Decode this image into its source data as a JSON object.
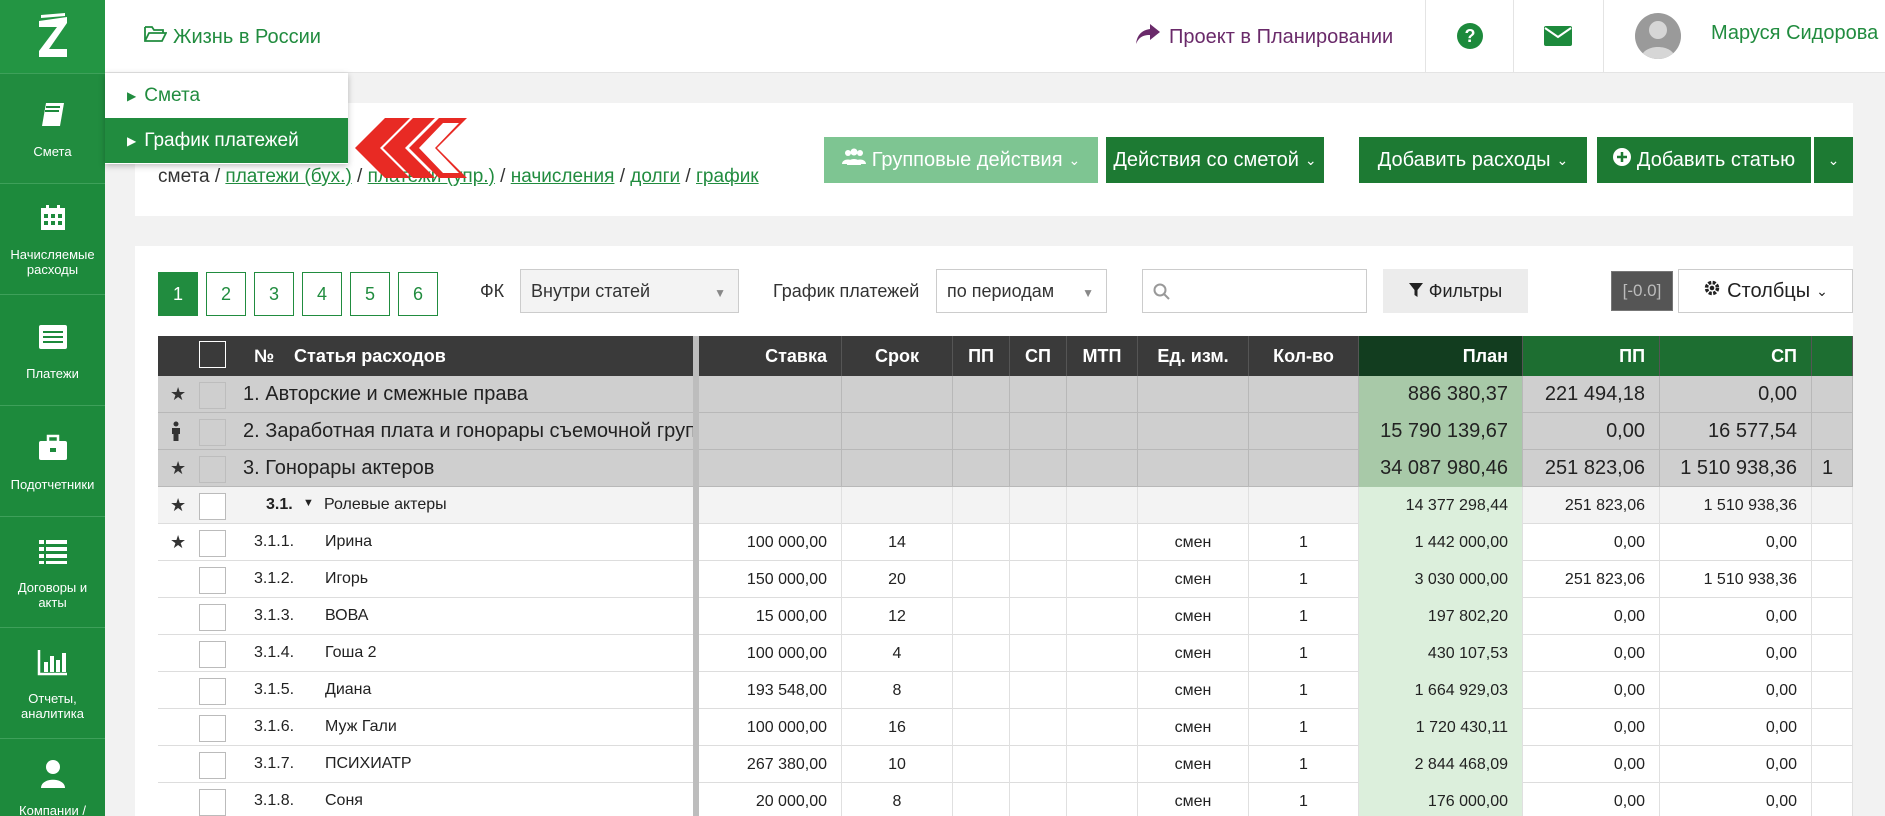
{
  "sidebar": {
    "items": [
      {
        "label": "Смета",
        "icon": "book-icon"
      },
      {
        "label": "Начисляемые расходы",
        "icon": "calendar-icon"
      },
      {
        "label": "Платежи",
        "icon": "list-box-icon"
      },
      {
        "label": "Подотчетники",
        "icon": "briefcase-icon"
      },
      {
        "label": "Договоры и акты",
        "icon": "list-icon"
      },
      {
        "label": "Отчеты, аналитика",
        "icon": "chart-icon"
      },
      {
        "label": "Компании /",
        "icon": "user-icon"
      }
    ]
  },
  "header": {
    "project": "Жизнь в России",
    "planning": "Проект в Планировании",
    "user": "Маруся Сидорова"
  },
  "dropdown": {
    "items": [
      "Смета",
      "График платежей"
    ]
  },
  "breadcrumb": {
    "first": "смета",
    "sep": " / ",
    "links": [
      "платежи (бух.)",
      "платежи (упр.)",
      "начисления",
      "долги",
      "график"
    ]
  },
  "actions": {
    "group": "Групповые действия",
    "estimate": "Действия со сметой",
    "add_expenses": "Добавить расходы",
    "add_item": "Добавить статью"
  },
  "toolbar": {
    "pages": [
      "1",
      "2",
      "3",
      "4",
      "5",
      "6"
    ],
    "fk_label": "ФК",
    "fk_value": "Внутри статей",
    "schedule_label": "График платежей",
    "schedule_value": "по периодам",
    "search_placeholder": "",
    "filters": "Фильтры",
    "version": "[-0.0]",
    "columns": "Столбцы"
  },
  "table": {
    "left_headers": {
      "num": "№",
      "name": "Статья расходов"
    },
    "right_headers": [
      "Ставка",
      "Срок",
      "ПП",
      "СП",
      "МТП",
      "Ед. изм.",
      "Кол-во",
      "План",
      "ПП",
      "СП"
    ],
    "groups": [
      {
        "name": "1. Авторские и смежные права",
        "plan": "886 380,37",
        "pp": "221 494,18",
        "sp": "0,00",
        "extra": ""
      },
      {
        "name": "2. Заработная плата и гонорары съемочной груп",
        "plan": "15 790 139,67",
        "pp": "0,00",
        "sp": "16 577,54",
        "extra": ""
      },
      {
        "name": "3. Гонорары актеров",
        "plan": "34 087 980,46",
        "pp": "251 823,06",
        "sp": "1 510 938,36",
        "extra": "1"
      }
    ],
    "subgroup": {
      "num": "3.1.",
      "name": "Ролевые актеры",
      "plan": "14 377 298,44",
      "pp": "251 823,06",
      "sp": "1 510 938,36"
    },
    "rows": [
      {
        "num": "3.1.1.",
        "name": "Ирина",
        "rate": "100 000,00",
        "term": "14",
        "unit": "смен",
        "qty": "1",
        "plan": "1 442 000,00",
        "pp": "0,00",
        "sp": "0,00"
      },
      {
        "num": "3.1.2.",
        "name": "Игорь",
        "rate": "150 000,00",
        "term": "20",
        "unit": "смен",
        "qty": "1",
        "plan": "3 030 000,00",
        "pp": "251 823,06",
        "sp": "1 510 938,36"
      },
      {
        "num": "3.1.3.",
        "name": "ВОВА",
        "rate": "15 000,00",
        "term": "12",
        "unit": "смен",
        "qty": "1",
        "plan": "197 802,20",
        "pp": "0,00",
        "sp": "0,00"
      },
      {
        "num": "3.1.4.",
        "name": "Гоша 2",
        "rate": "100 000,00",
        "term": "4",
        "unit": "смен",
        "qty": "1",
        "plan": "430 107,53",
        "pp": "0,00",
        "sp": "0,00"
      },
      {
        "num": "3.1.5.",
        "name": "Диана",
        "rate": "193 548,00",
        "term": "8",
        "unit": "смен",
        "qty": "1",
        "plan": "1 664 929,03",
        "pp": "0,00",
        "sp": "0,00"
      },
      {
        "num": "3.1.6.",
        "name": "Муж Гали",
        "rate": "100 000,00",
        "term": "16",
        "unit": "смен",
        "qty": "1",
        "plan": "1 720 430,11",
        "pp": "0,00",
        "sp": "0,00"
      },
      {
        "num": "3.1.7.",
        "name": "ПСИХИАТР",
        "rate": "267 380,00",
        "term": "10",
        "unit": "смен",
        "qty": "1",
        "plan": "2 844 468,09",
        "pp": "0,00",
        "sp": "0,00"
      },
      {
        "num": "3.1.8.",
        "name": "Соня",
        "rate": "20 000,00",
        "term": "8",
        "unit": "смен",
        "qty": "1",
        "plan": "176 000,00",
        "pp": "0,00",
        "sp": "0,00"
      }
    ]
  }
}
